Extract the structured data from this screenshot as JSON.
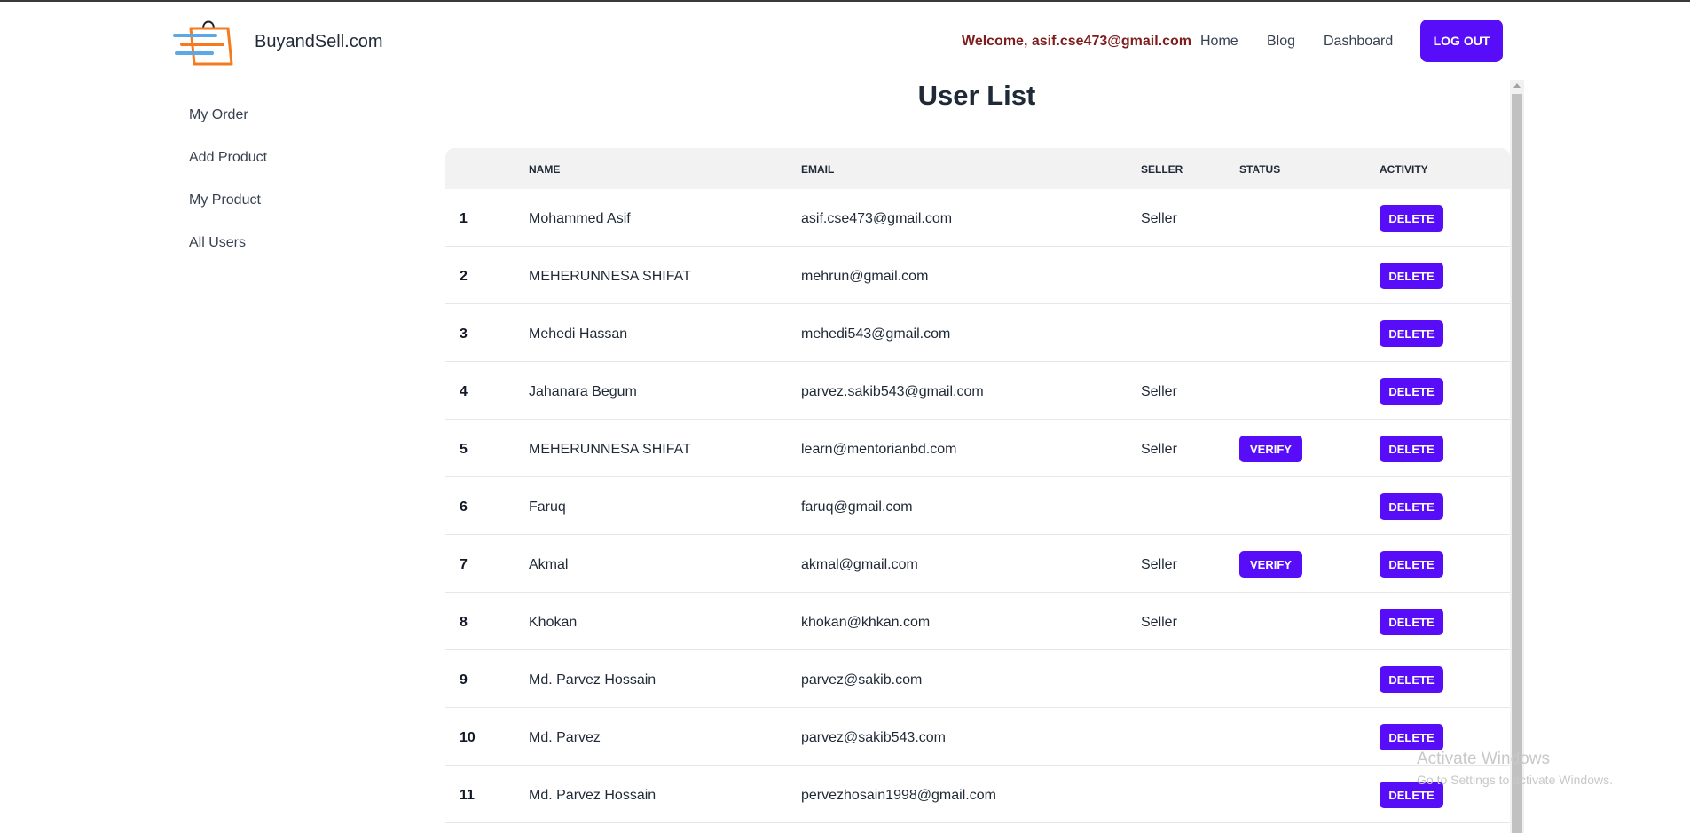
{
  "brand": {
    "name": "BuyandSell.com",
    "logo_icon": "shopping-bag-icon"
  },
  "nav": {
    "welcome": "Welcome, asif.cse473@gmail.com",
    "home": "Home",
    "blog": "Blog",
    "dashboard": "Dashboard",
    "logout": "LOG OUT"
  },
  "sidebar": {
    "items": [
      {
        "label": "My Order"
      },
      {
        "label": "Add Product"
      },
      {
        "label": "My Product"
      },
      {
        "label": "All Users"
      }
    ]
  },
  "page": {
    "title": "User List"
  },
  "table": {
    "headers": {
      "name": "NAME",
      "email": "EMAIL",
      "seller": "SELLER",
      "status": "STATUS",
      "activity": "ACTIVITY"
    },
    "verify_label": "VERIFY",
    "delete_label": "DELETE",
    "rows": [
      {
        "num": "1",
        "name": "Mohammed Asif",
        "email": "asif.cse473@gmail.com",
        "seller": "Seller",
        "verify": false
      },
      {
        "num": "2",
        "name": "MEHERUNNESA SHIFAT",
        "email": "mehrun@gmail.com",
        "seller": "",
        "verify": false
      },
      {
        "num": "3",
        "name": "Mehedi Hassan",
        "email": "mehedi543@gmail.com",
        "seller": "",
        "verify": false
      },
      {
        "num": "4",
        "name": "Jahanara Begum",
        "email": "parvez.sakib543@gmail.com",
        "seller": "Seller",
        "verify": false
      },
      {
        "num": "5",
        "name": "MEHERUNNESA SHIFAT",
        "email": "learn@mentorianbd.com",
        "seller": "Seller",
        "verify": true
      },
      {
        "num": "6",
        "name": "Faruq",
        "email": "faruq@gmail.com",
        "seller": "",
        "verify": false
      },
      {
        "num": "7",
        "name": "Akmal",
        "email": "akmal@gmail.com",
        "seller": "Seller",
        "verify": true
      },
      {
        "num": "8",
        "name": "Khokan",
        "email": "khokan@khkan.com",
        "seller": "Seller",
        "verify": false
      },
      {
        "num": "9",
        "name": "Md. Parvez Hossain",
        "email": "parvez@sakib.com",
        "seller": "",
        "verify": false
      },
      {
        "num": "10",
        "name": "Md. Parvez",
        "email": "parvez@sakib543.com",
        "seller": "",
        "verify": false
      },
      {
        "num": "11",
        "name": "Md. Parvez Hossain",
        "email": "pervezhosain1998@gmail.com",
        "seller": "",
        "verify": false
      }
    ]
  },
  "watermark": {
    "title": "Activate Windows",
    "subtitle": "Go to Settings to activate Windows."
  },
  "colors": {
    "primary": "#570df8",
    "welcome": "#7f1d1d",
    "header_bg": "#f2f2f2"
  }
}
